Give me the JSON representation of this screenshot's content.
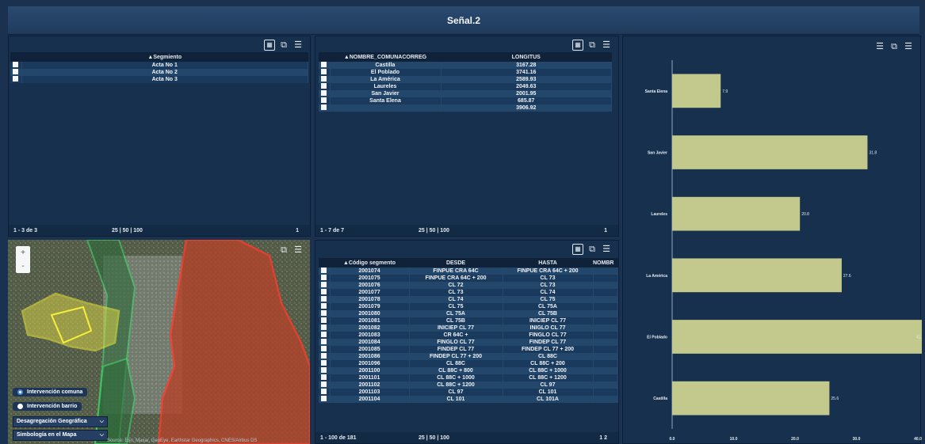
{
  "app": {
    "title": "Señal.2"
  },
  "segment_panel": {
    "header": "▲Segmiento",
    "rows": [
      "Acta No 1",
      "Acta No 2",
      "Acta No 3"
    ],
    "footer": {
      "count": "1 - 3 de 3",
      "pager": "25 | 50 | 100",
      "page": "1"
    }
  },
  "comuna_panel": {
    "headers": [
      "▲NOMBRE_COMUNACORREG",
      "LONGITUS"
    ],
    "rows": [
      [
        "Castilla",
        "3167.28"
      ],
      [
        "El Poblado",
        "3741.16"
      ],
      [
        "La América",
        "2589.93"
      ],
      [
        "Laureles",
        "2049.63"
      ],
      [
        "San Javier",
        "2001.95"
      ],
      [
        "Santa Elena",
        "685.87"
      ],
      [
        "",
        "3906.92"
      ]
    ],
    "footer": {
      "count": "1 - 7 de 7",
      "pager": "25 | 50 | 100",
      "page": "1"
    }
  },
  "segments_table": {
    "headers": [
      "▲Código segmento",
      "DESDE",
      "HASTA",
      "NOMBR"
    ],
    "rows": [
      [
        "2001074",
        "FINPUE CRA 64C",
        "FINPUE CRA 64C + 200",
        ""
      ],
      [
        "2001075",
        "FINPUE CRA 64C + 200",
        "CL 73",
        ""
      ],
      [
        "2001076",
        "CL 72",
        "CL 73",
        ""
      ],
      [
        "2001077",
        "CL 73",
        "CL 74",
        ""
      ],
      [
        "2001078",
        "CL 74",
        "CL 75",
        ""
      ],
      [
        "2001079",
        "CL 75",
        "CL 75A",
        ""
      ],
      [
        "2001080",
        "CL 75A",
        "CL 75B",
        ""
      ],
      [
        "2001081",
        "CL 75B",
        "INICIEP CL 77",
        ""
      ],
      [
        "2001082",
        "INICIEP CL 77",
        "INIGLO CL 77",
        ""
      ],
      [
        "2001083",
        "CR 64C +",
        "FINGLO CL 77",
        ""
      ],
      [
        "2001084",
        "FINGLO CL 77",
        "FINDEP CL 77",
        ""
      ],
      [
        "2001085",
        "FINDEP CL 77",
        "FINDEP CL 77 + 200",
        ""
      ],
      [
        "2001086",
        "FINDEP CL 77 + 200",
        "CL 88C",
        ""
      ],
      [
        "2001096",
        "CL 88C",
        "CL 88C + 200",
        ""
      ],
      [
        "2001100",
        "CL 88C + 800",
        "CL 88C + 1000",
        ""
      ],
      [
        "2001101",
        "CL 88C + 1000",
        "CL 88C + 1200",
        ""
      ],
      [
        "2001102",
        "CL 88C + 1200",
        "CL 97",
        ""
      ],
      [
        "2001103",
        "CL 97",
        "CL 101",
        ""
      ],
      [
        "2001104",
        "CL 101",
        "CL 101A",
        ""
      ]
    ],
    "footer": {
      "count": "1 - 100 de 181",
      "pager": "25 | 50 | 100",
      "page": "1 2"
    }
  },
  "map": {
    "zoom_in": "+",
    "zoom_out": "-",
    "options": [
      "Intervención comuna",
      "Intervención barrio"
    ],
    "selects": [
      "Desagregación Geográfica",
      "Simbología en el Mapa"
    ],
    "attribution": "Source: Esri, Maxar, GeoEye, Earthstar Geographics, CNES/Airbus DS"
  },
  "chart_data": {
    "type": "bar",
    "orientation": "horizontal",
    "categories": [
      "Santa Elena",
      "San Javier",
      "Laureles",
      "La América",
      "El Poblado",
      "Castilla"
    ],
    "values": [
      7.9,
      31.8,
      20.8,
      27.6,
      41.2,
      25.6
    ],
    "xlim": [
      0,
      40
    ],
    "x_ticks": [
      "0.0",
      "10.0",
      "20.0",
      "30.0",
      "40.0"
    ],
    "bar_color": "#c3c98d"
  }
}
